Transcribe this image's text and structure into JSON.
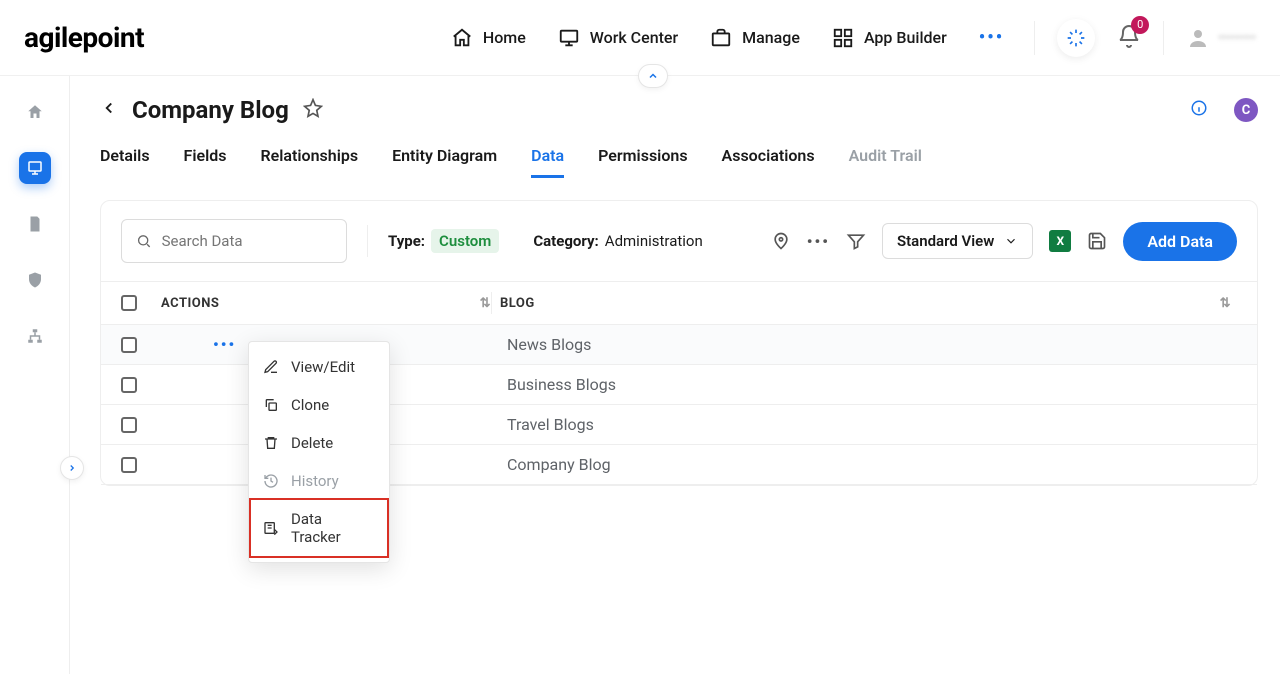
{
  "logo": "agilepoint",
  "nav": {
    "items": [
      {
        "label": "Home"
      },
      {
        "label": "Work Center"
      },
      {
        "label": "Manage"
      },
      {
        "label": "App Builder"
      }
    ]
  },
  "notifications": {
    "count": "0"
  },
  "user": {
    "name": "••••••••"
  },
  "page": {
    "title": "Company Blog"
  },
  "tabs": {
    "items": [
      {
        "label": "Details"
      },
      {
        "label": "Fields"
      },
      {
        "label": "Relationships"
      },
      {
        "label": "Entity Diagram"
      },
      {
        "label": "Data",
        "active": true
      },
      {
        "label": "Permissions"
      },
      {
        "label": "Associations"
      },
      {
        "label": "Audit Trail",
        "disabled": true
      }
    ]
  },
  "toolbar": {
    "search_placeholder": "Search Data",
    "type_label": "Type:",
    "type_value": "Custom",
    "category_label": "Category:",
    "category_value": "Administration",
    "view_label": "Standard View",
    "add_label": "Add Data"
  },
  "table": {
    "columns": {
      "actions": "ACTIONS",
      "blog": "BLOG"
    },
    "rows": [
      {
        "blog": "News Blogs",
        "showDots": true,
        "hover": true
      },
      {
        "blog": "Business Blogs"
      },
      {
        "blog": "Travel Blogs"
      },
      {
        "blog": "Company Blog"
      }
    ]
  },
  "ctx": {
    "items": [
      {
        "label": "View/Edit"
      },
      {
        "label": "Clone"
      },
      {
        "label": "Delete"
      },
      {
        "label": "History",
        "disabled": true
      },
      {
        "label": "Data Tracker",
        "highlight": true
      }
    ]
  },
  "copilot_letter": "C"
}
